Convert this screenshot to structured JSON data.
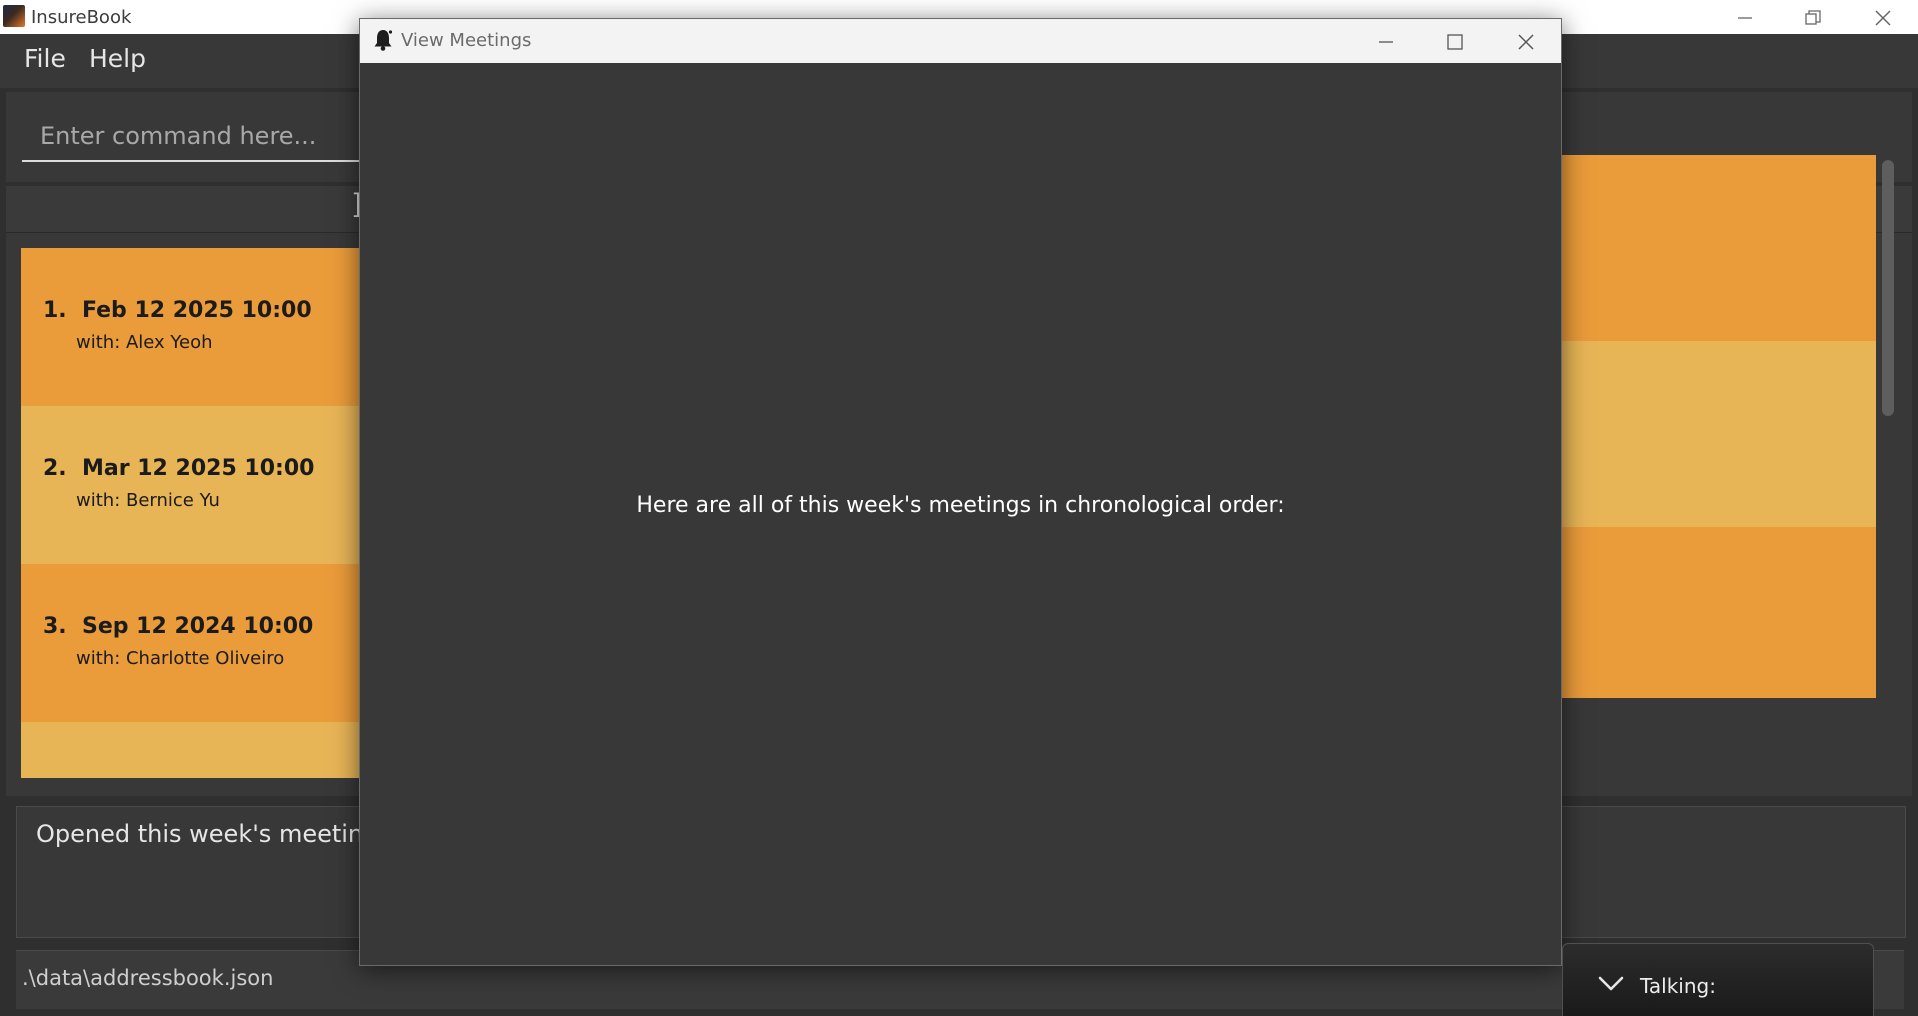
{
  "window": {
    "title": "InsureBook",
    "controls": {
      "minimize": "minimize-icon",
      "restore": "restore-icon",
      "close": "close-icon"
    }
  },
  "menu": {
    "items": [
      {
        "label": "File"
      },
      {
        "label": "Help"
      }
    ]
  },
  "command": {
    "placeholder": "Enter command here..."
  },
  "list": {
    "header_glyph": "I",
    "meetings": [
      {
        "index": "1.",
        "datetime": "Feb 12 2025 10:00",
        "with": "with: Alex Yeoh"
      },
      {
        "index": "2.",
        "datetime": "Mar 12 2025 10:00",
        "with": "with: Bernice Yu"
      },
      {
        "index": "3.",
        "datetime": "Sep 12 2024 10:00",
        "with": "with: Charlotte Oliveiro"
      }
    ]
  },
  "result": {
    "text": "Opened this week's meetings"
  },
  "status": {
    "path": ".\\data\\addressbook.json"
  },
  "modal": {
    "title": "View Meetings",
    "icon": "bell-icon",
    "message": "Here are all of this week's meetings in chronological order:"
  },
  "popup": {
    "label": "Talking:",
    "icon": "chevron-down-icon"
  },
  "colors": {
    "card_dark": "#ea9b3a",
    "card_light": "#e7b456",
    "panel_bg": "#383838",
    "window_bg": "#2f2f2f"
  }
}
